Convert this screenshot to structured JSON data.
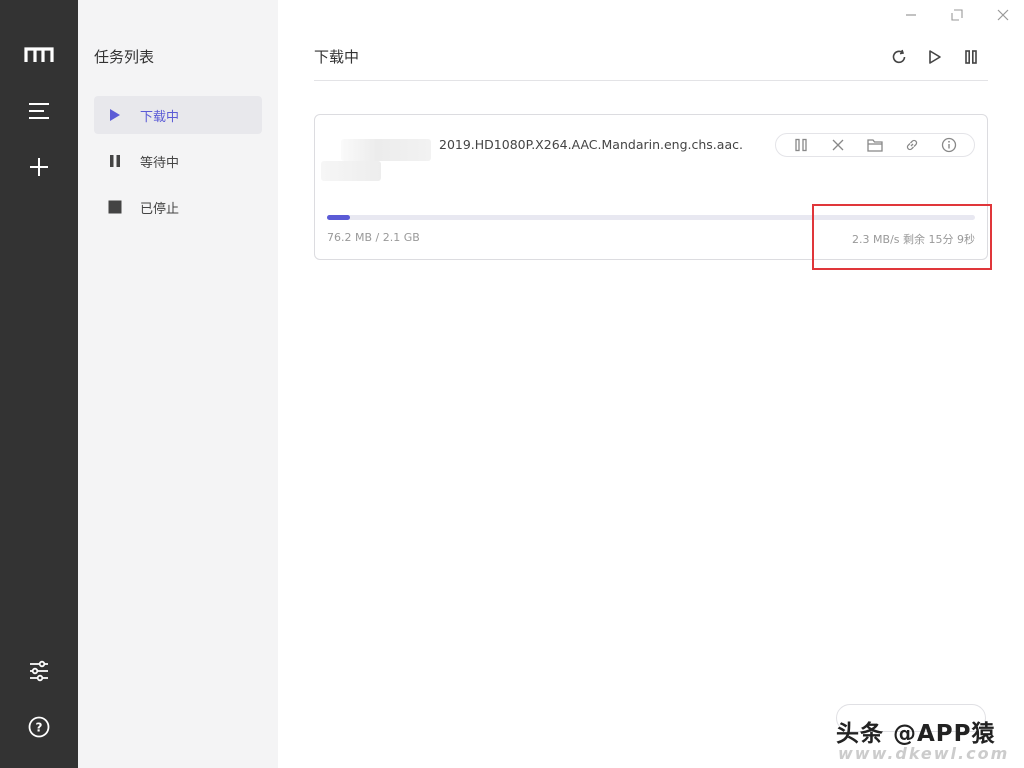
{
  "sidebar": {
    "icons": [
      "logo-icon",
      "menu-icon",
      "add-icon",
      "settings-sliders-icon",
      "help-icon"
    ]
  },
  "tasks": {
    "title": "任务列表",
    "items": [
      {
        "label": "下载中",
        "icon": "play-icon",
        "active": true
      },
      {
        "label": "等待中",
        "icon": "pause-icon",
        "active": false
      },
      {
        "label": "已停止",
        "icon": "stop-icon",
        "active": false
      }
    ]
  },
  "main": {
    "heading": "下载中",
    "toolbar_icons": [
      "refresh-icon",
      "play-icon",
      "pause-icon"
    ],
    "window_controls": [
      "minimize-icon",
      "maximize-icon",
      "close-icon"
    ]
  },
  "download": {
    "filename": "2019.HD1080P.X264.AAC.Mandarin.eng.chs.aac.",
    "progress_fraction": 0.036,
    "size_text": "76.2 MB / 2.1 GB",
    "speed_text": "2.3 MB/s 剩余 15分 9秒",
    "actions": [
      "pause-icon",
      "delete-icon",
      "folder-icon",
      "link-icon",
      "info-icon"
    ]
  },
  "colors": {
    "accent": "#5b5bd6",
    "rail": "#333333",
    "highlight": "#e0363a"
  },
  "watermark": {
    "text": "头条 @APP猿",
    "site": "www.dkewl.com"
  }
}
